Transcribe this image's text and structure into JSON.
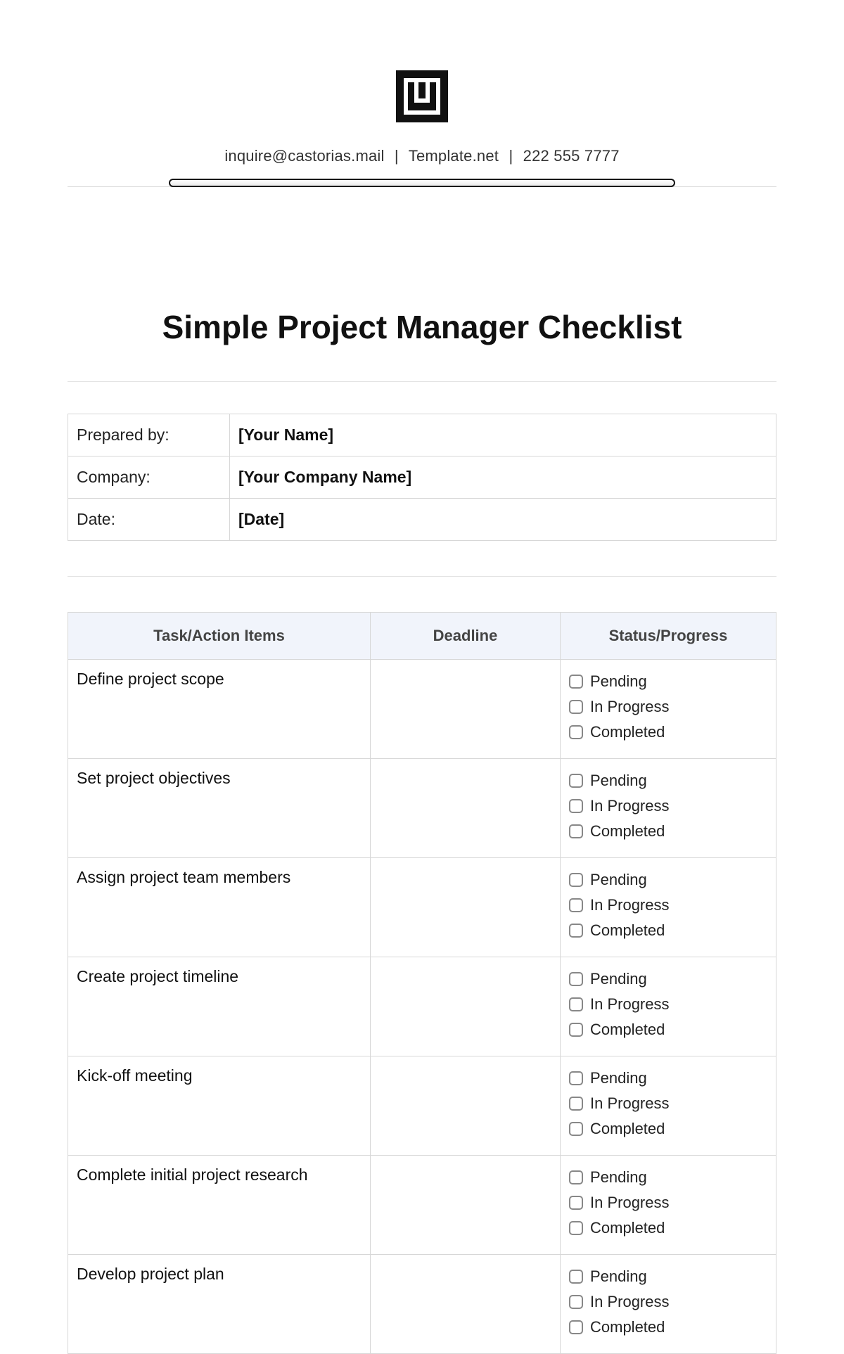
{
  "header": {
    "contact_email": "inquire@castorias.mail",
    "contact_site": "Template.net",
    "contact_phone": "222 555 7777"
  },
  "title": "Simple Project Manager Checklist",
  "info": {
    "prepared_by_label": "Prepared by:",
    "prepared_by_value": "[Your Name]",
    "company_label": "Company:",
    "company_value": "[Your Company Name]",
    "date_label": "Date:",
    "date_value": "[Date]"
  },
  "columns": {
    "task": "Task/Action Items",
    "deadline": "Deadline",
    "status": "Status/Progress"
  },
  "status_options": [
    "Pending",
    "In Progress",
    "Completed"
  ],
  "tasks": [
    {
      "name": "Define project scope",
      "deadline": ""
    },
    {
      "name": "Set project objectives",
      "deadline": ""
    },
    {
      "name": "Assign project team members",
      "deadline": ""
    },
    {
      "name": "Create project timeline",
      "deadline": ""
    },
    {
      "name": "Kick-off meeting",
      "deadline": ""
    },
    {
      "name": "Complete initial project research",
      "deadline": ""
    },
    {
      "name": "Develop project plan",
      "deadline": ""
    }
  ]
}
